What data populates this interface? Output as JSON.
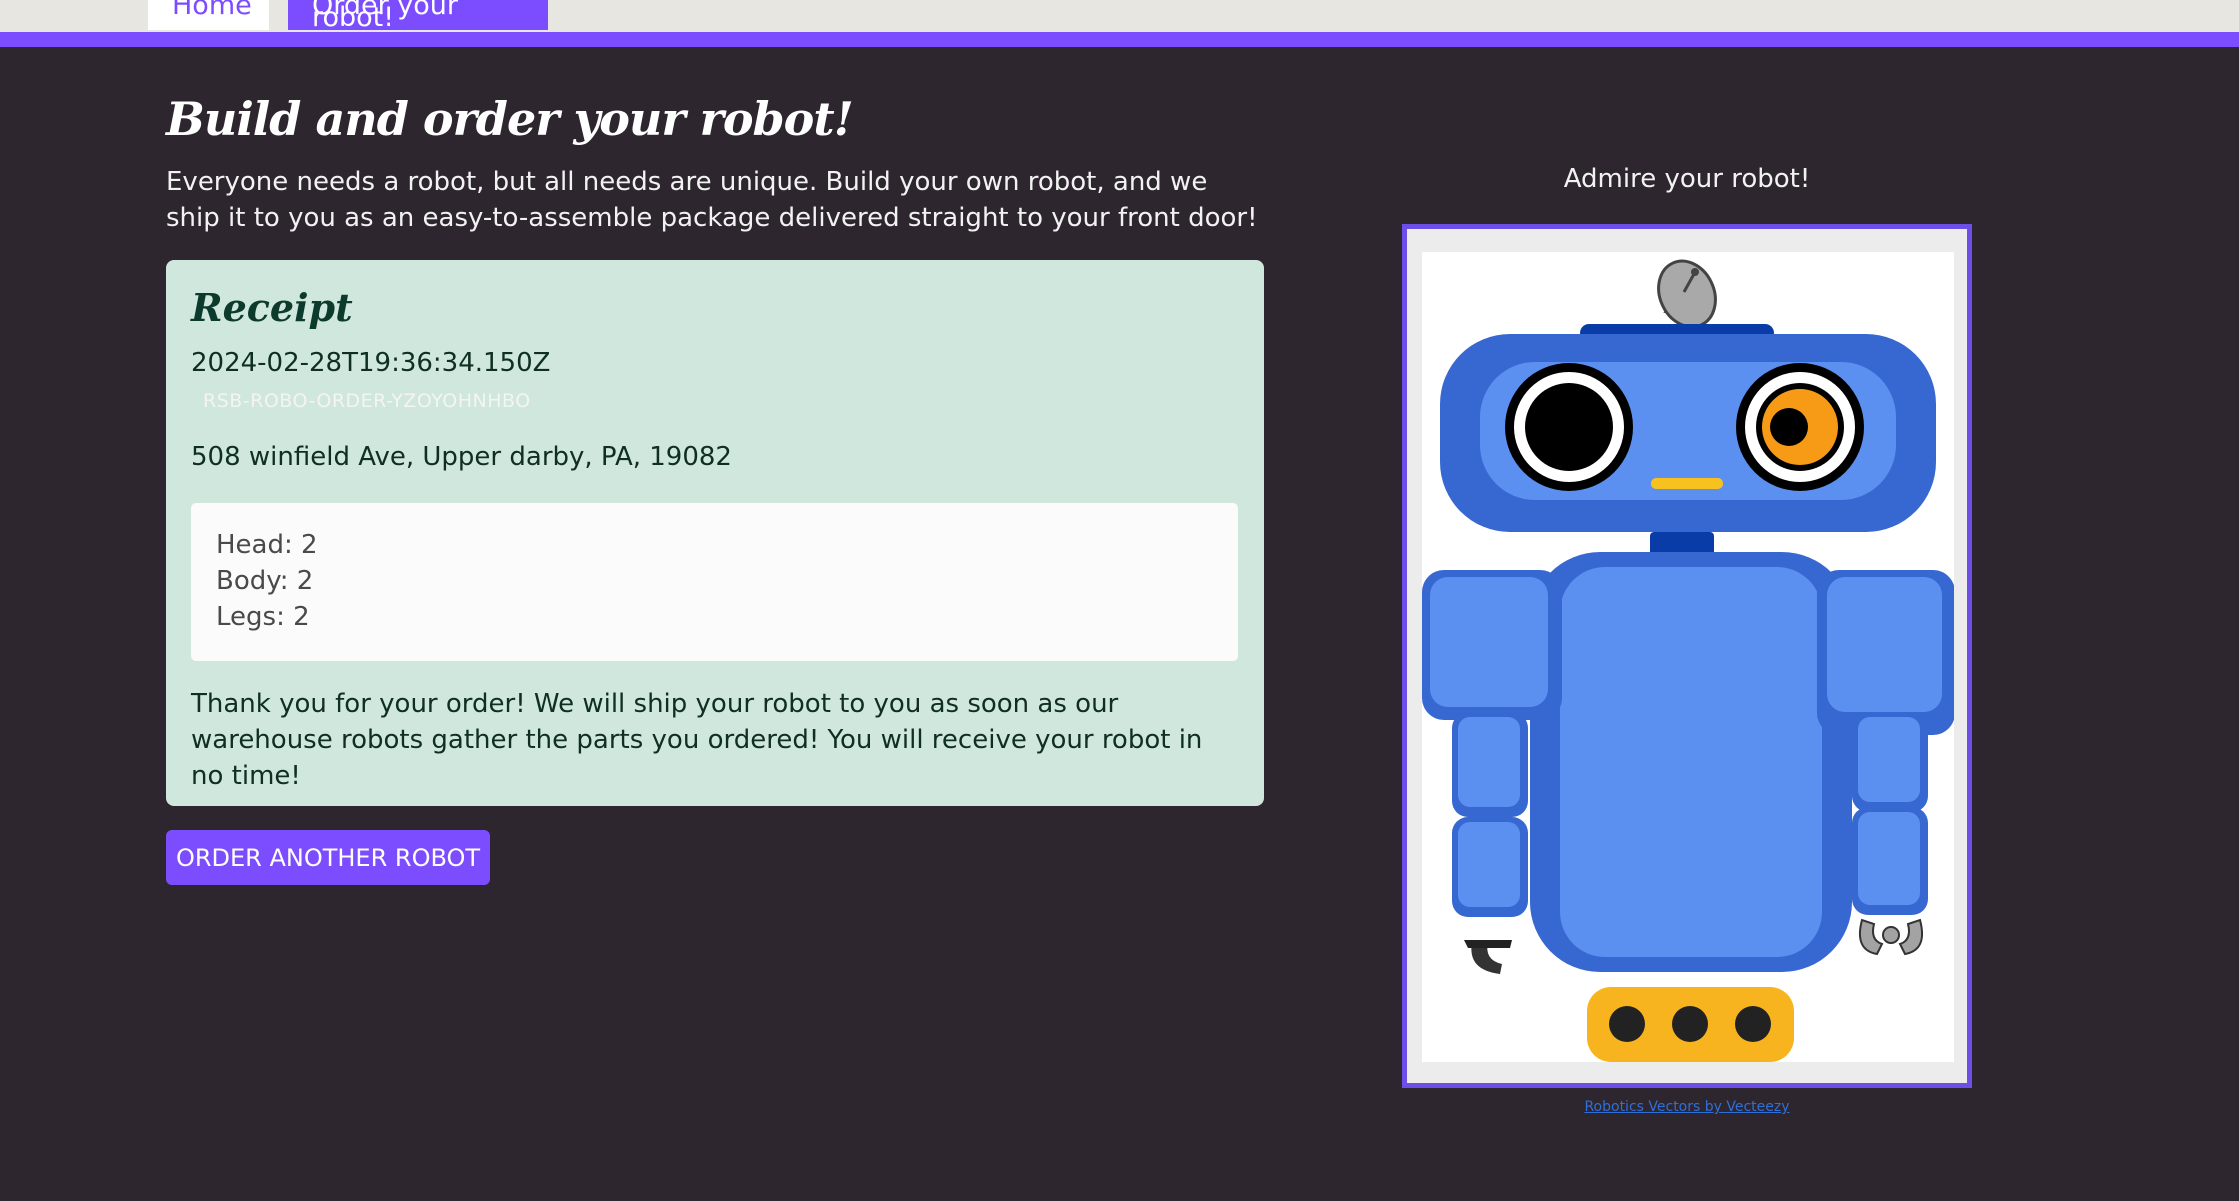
{
  "nav": {
    "tabs": [
      {
        "label": "Home"
      },
      {
        "label": "Order your robot!"
      }
    ]
  },
  "page": {
    "title": "Build and order your robot!",
    "intro": "Everyone needs a robot, but all needs are unique. Build your own robot, and we ship it to you as an easy-to-assemble package delivered straight to your front door!"
  },
  "receipt": {
    "title": "Receipt",
    "timestamp": "2024-02-28T19:36:34.150Z",
    "order_id": "RSB-ROBO-ORDER-YZOYOHNHBO",
    "address": "508 winfield Ave, Upper darby, PA, 19082",
    "parts": {
      "head": "Head: 2",
      "body": "Body: 2",
      "legs": "Legs: 2"
    },
    "thank_you": "Thank you for your order! We will ship your robot to you as soon as our warehouse robots gather the parts you ordered! You will receive your robot in no time!"
  },
  "actions": {
    "order_another_label": "ORDER ANOTHER ROBOT"
  },
  "preview": {
    "title": "Admire your robot!",
    "credit": "Robotics Vectors by Vecteezy"
  },
  "colors": {
    "background": "#2d262e",
    "accent": "#7c4dff",
    "receipt_bg": "#d0e7dd",
    "robot_blue": "#3768d2",
    "robot_light_blue": "#5b8ff0",
    "robot_yellow": "#f7b41f"
  }
}
